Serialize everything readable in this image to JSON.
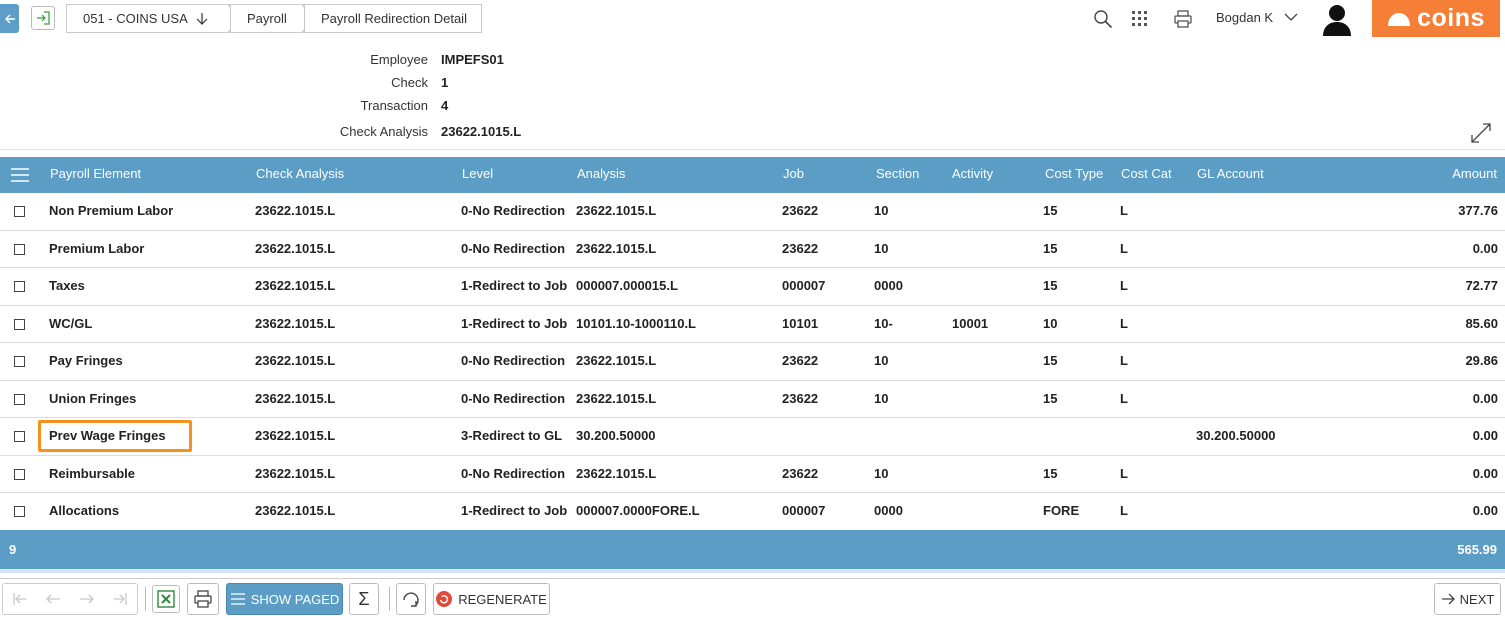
{
  "breadcrumbs": [
    {
      "label": "051 - COINS USA"
    },
    {
      "label": "Payroll"
    },
    {
      "label": "Payroll Redirection Detail"
    }
  ],
  "user": {
    "name": "Bogdan K"
  },
  "logo": {
    "text": "coins"
  },
  "info": {
    "employee_label": "Employee",
    "employee_value": "IMPEFS01",
    "check_label": "Check",
    "check_value": "1",
    "transaction_label": "Transaction",
    "transaction_value": "4",
    "check_analysis_label": "Check Analysis",
    "check_analysis_value": "23622.1015.L"
  },
  "table": {
    "headers": [
      "Payroll Element",
      "Check Analysis",
      "Level",
      "Analysis",
      "Job",
      "Section",
      "Activity",
      "Cost Type",
      "Cost Cat",
      "GL Account",
      "Amount"
    ],
    "rows": [
      [
        "Non Premium Labor",
        "23622.1015.L",
        "0-No Redirection",
        "23622.1015.L",
        "23622",
        "10",
        "",
        "15",
        "L",
        "",
        "377.76"
      ],
      [
        "Premium Labor",
        "23622.1015.L",
        "0-No Redirection",
        "23622.1015.L",
        "23622",
        "10",
        "",
        "15",
        "L",
        "",
        "0.00"
      ],
      [
        "Taxes",
        "23622.1015.L",
        "1-Redirect to Job",
        "000007.000015.L",
        "000007",
        "0000",
        "",
        "15",
        "L",
        "",
        "72.77"
      ],
      [
        "WC/GL",
        "23622.1015.L",
        "1-Redirect to Job",
        "10101.10-1000110.L",
        "10101",
        "10-",
        "10001",
        "10",
        "L",
        "",
        "85.60"
      ],
      [
        "Pay Fringes",
        "23622.1015.L",
        "0-No Redirection",
        "23622.1015.L",
        "23622",
        "10",
        "",
        "15",
        "L",
        "",
        "29.86"
      ],
      [
        "Union Fringes",
        "23622.1015.L",
        "0-No Redirection",
        "23622.1015.L",
        "23622",
        "10",
        "",
        "15",
        "L",
        "",
        "0.00"
      ],
      [
        "Prev Wage Fringes",
        "23622.1015.L",
        "3-Redirect to GL",
        "30.200.50000",
        "",
        "",
        "",
        "",
        "",
        "30.200.50000",
        "0.00"
      ],
      [
        "Reimbursable",
        "23622.1015.L",
        "0-No Redirection",
        "23622.1015.L",
        "23622",
        "10",
        "",
        "15",
        "L",
        "",
        "0.00"
      ],
      [
        "Allocations",
        "23622.1015.L",
        "1-Redirect to Job",
        "000007.0000FORE.L",
        "000007",
        "0000",
        "",
        "FORE",
        "L",
        "",
        "0.00"
      ]
    ],
    "footer": {
      "count": "9",
      "total": "565.99"
    }
  },
  "toolbar": {
    "show_paged_label": "SHOW PAGED",
    "regenerate_label": "REGENERATE",
    "next_label": "NEXT"
  },
  "colors": {
    "accent_blue": "#5c9dc6",
    "brand_orange": "#f57f36",
    "highlight_orange": "#f7901e"
  }
}
